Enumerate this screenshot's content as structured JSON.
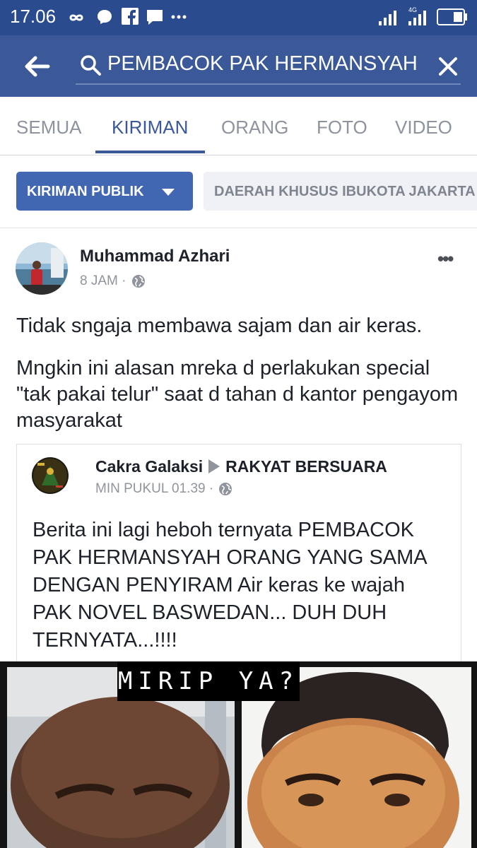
{
  "status_bar": {
    "time": "17.06",
    "icons": [
      "infinity-icon",
      "messenger-icon",
      "facebook-icon",
      "chat-icon",
      "more-dots-icon",
      "signal-icon",
      "signal-4g-icon",
      "battery-icon"
    ]
  },
  "app_bar": {
    "search_query": "PEMBACOK PAK HERMANSYAH"
  },
  "tabs": [
    {
      "label": "SEMUA",
      "active": false
    },
    {
      "label": "KIRIMAN",
      "active": true
    },
    {
      "label": "ORANG",
      "active": false
    },
    {
      "label": "FOTO",
      "active": false
    },
    {
      "label": "VIDEO",
      "active": false
    }
  ],
  "filters": {
    "primary": "KIRIMAN PUBLIK",
    "secondary": "DAERAH KHUSUS IBUKOTA JAKARTA"
  },
  "post": {
    "author": "Muhammad Azhari",
    "time": "8 JAM",
    "separator": "·",
    "paragraphs": [
      "Tidak sngaja membawa sajam dan air keras.",
      "Mngkin ini alasan mreka d perlakukan special \"tak pakai telur\" saat d tahan d kantor pengayom masyarakat"
    ],
    "shared": {
      "author": "Cakra Galaksi",
      "group": "RAKYAT  BERSUARA",
      "time": "MIN PUKUL 01.39",
      "separator": "·",
      "text": "Berita ini lagi heboh ternyata PEMBACOK PAK HERMANSYAH ORANG YANG SAMA DENGAN PENYIRAM Air keras ke wajah PAK NOVEL BASWEDAN... DUH DUH TERNYATA...!!!!"
    }
  },
  "image": {
    "caption": "MIRIP  YA?"
  },
  "colors": {
    "status_bar": "#2a4b8d",
    "app_bar": "#3b5998",
    "accent": "#4267b2",
    "text": "#1d2129",
    "muted": "#90949c"
  }
}
